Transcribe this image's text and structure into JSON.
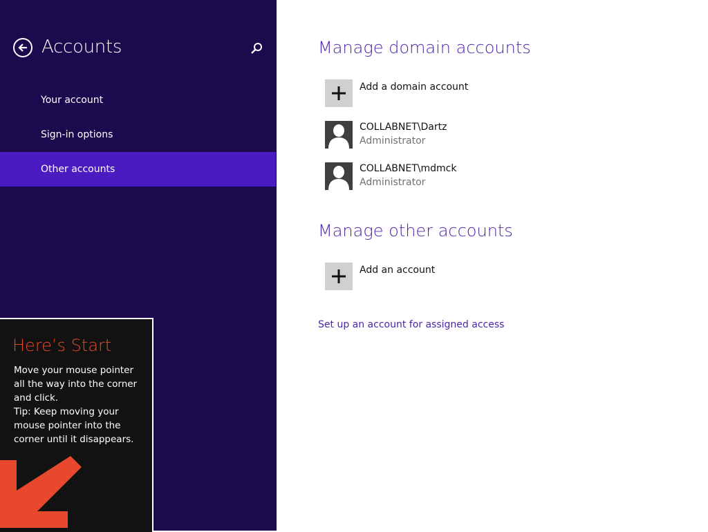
{
  "sidebar": {
    "title": "Accounts",
    "back_icon": "back-arrow-circle-icon",
    "search_icon": "search-icon",
    "items": [
      {
        "label": "Your account",
        "active": false
      },
      {
        "label": "Sign-in options",
        "active": false
      },
      {
        "label": "Other accounts",
        "active": true
      }
    ],
    "colors": {
      "background": "#1b0a4d",
      "active": "#4b1bc2"
    }
  },
  "start_tip": {
    "title": "Here’s Start",
    "body": "Move your mouse pointer\nall the way into the corner\nand click.\nTip: Keep moving your\nmouse pointer into the\ncorner until it disappears.",
    "arrow_icon": "corner-arrow-icon",
    "title_color": "#e8492c"
  },
  "main": {
    "domain_section": {
      "heading": "Manage domain accounts",
      "add_label": "Add a domain account",
      "accounts": [
        {
          "name": "COLLABNET\\Dartz",
          "role": "Administrator"
        },
        {
          "name": "COLLABNET\\mdmck",
          "role": "Administrator"
        }
      ]
    },
    "other_section": {
      "heading": "Manage other accounts",
      "add_label": "Add an account"
    },
    "assigned_access_link": "Set up an account for assigned access",
    "accent_color": "#4b25a8"
  }
}
